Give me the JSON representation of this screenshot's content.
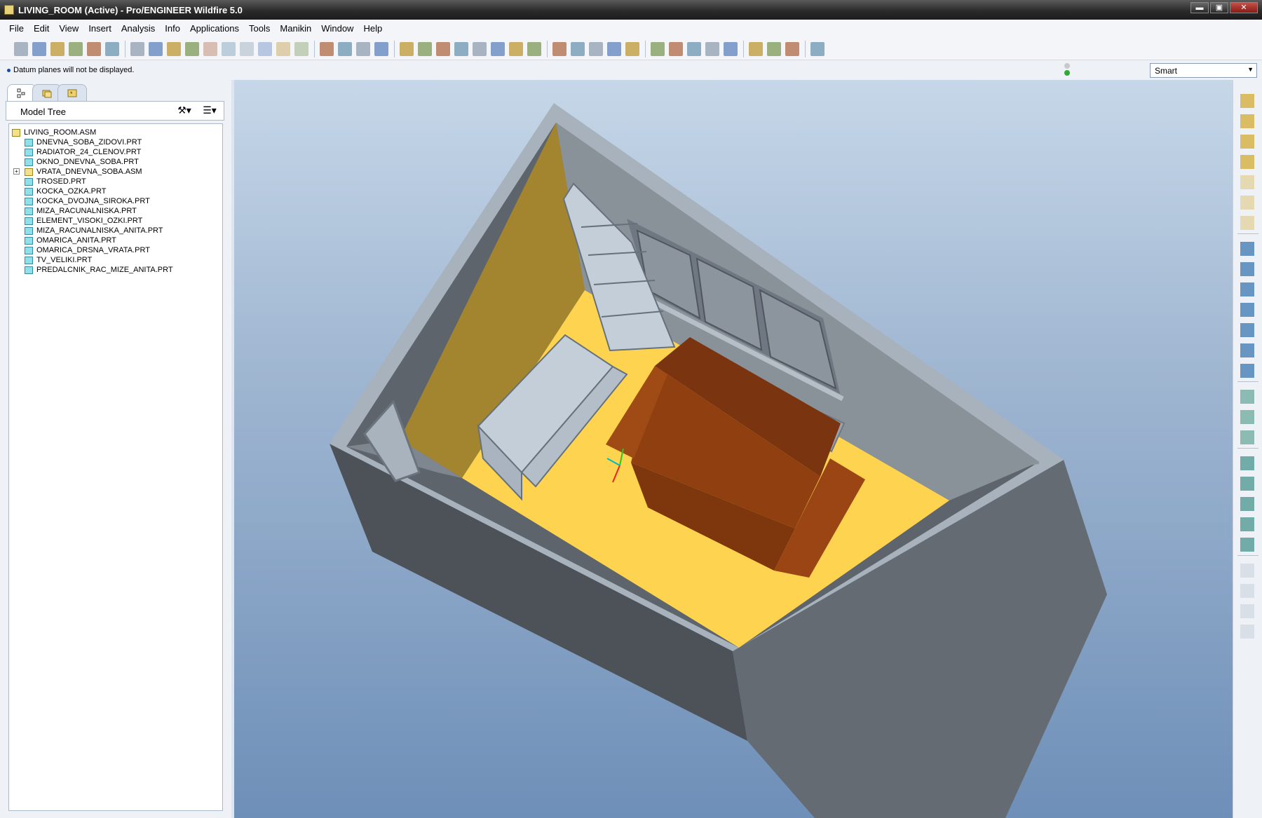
{
  "window": {
    "title": "LIVING_ROOM (Active) - Pro/ENGINEER Wildfire 5.0",
    "minimize": "▬",
    "maximize": "▣",
    "close": "✕"
  },
  "menu": [
    "File",
    "Edit",
    "View",
    "Insert",
    "Analysis",
    "Info",
    "Applications",
    "Tools",
    "Manikin",
    "Window",
    "Help"
  ],
  "status": {
    "message": "Datum planes will not be displayed.",
    "filter_value": "Smart"
  },
  "model_tree": {
    "header": "Model Tree",
    "items": [
      {
        "label": "LIVING_ROOM.ASM",
        "type": "asm",
        "level": 0,
        "expandable": false
      },
      {
        "label": "DNEVNA_SOBA_ZIDOVI.PRT",
        "type": "prt",
        "level": 1,
        "expandable": false
      },
      {
        "label": "RADIATOR_24_CLENOV.PRT",
        "type": "prt",
        "level": 1,
        "expandable": false
      },
      {
        "label": "OKNO_DNEVNA_SOBA.PRT",
        "type": "prt",
        "level": 1,
        "expandable": false
      },
      {
        "label": "VRATA_DNEVNA_SOBA.ASM",
        "type": "asm",
        "level": 1,
        "expandable": true
      },
      {
        "label": "TROSED.PRT",
        "type": "prt",
        "level": 1,
        "expandable": false
      },
      {
        "label": "KOCKA_OZKA.PRT",
        "type": "prt",
        "level": 1,
        "expandable": false
      },
      {
        "label": "KOCKA_DVOJNA_SIROKA.PRT",
        "type": "prt",
        "level": 1,
        "expandable": false
      },
      {
        "label": "MIZA_RACUNALNISKA.PRT",
        "type": "prt",
        "level": 1,
        "expandable": false
      },
      {
        "label": "ELEMENT_VISOKI_OZKI.PRT",
        "type": "prt",
        "level": 1,
        "expandable": false
      },
      {
        "label": "MIZA_RACUNALNISKA_ANITA.PRT",
        "type": "prt",
        "level": 1,
        "expandable": false
      },
      {
        "label": "OMARICA_ANITA.PRT",
        "type": "prt",
        "level": 1,
        "expandable": false
      },
      {
        "label": "OMARICA_DRSNA_VRATA.PRT",
        "type": "prt",
        "level": 1,
        "expandable": false
      },
      {
        "label": "TV_VELIKI.PRT",
        "type": "prt",
        "level": 1,
        "expandable": false
      },
      {
        "label": "PREDALCNIK_RAC_MIZE_ANITA.PRT",
        "type": "prt",
        "level": 1,
        "expandable": false
      }
    ]
  },
  "toolbar_icons": [
    "new-icon",
    "open-icon",
    "save-icon",
    "print-icon",
    "quick-print-icon",
    "email-icon",
    "undo-icon",
    "redo-icon",
    "cut-icon",
    "copy-icon",
    "paste-icon",
    "paste-special-icon",
    "regenerate-icon",
    "regenerate-manager-icon",
    "find-icon",
    "select-box-icon",
    "sketch-icon",
    "axis-icon",
    "spin-center-icon",
    "render-sphere-icon",
    "pan-icon",
    "zoom-in-icon",
    "zoom-out-icon",
    "refit-icon",
    "reorient-icon",
    "saved-views-icon",
    "layers-icon",
    "view-manager-icon",
    "wireframe-icon",
    "hidden-line-icon",
    "no-hidden-icon",
    "shading-icon",
    "enhanced-realism-icon",
    "datum-plane-display-icon",
    "datum-axis-display-icon",
    "point-display-icon",
    "csys-display-icon",
    "annotation-display-icon",
    "window-activate-icon",
    "window-close-icon",
    "window-cancel-icon",
    "context-help-icon"
  ],
  "right_icons": [
    "assemble-icon",
    "create-component-icon",
    "package-icon",
    "cable-icon",
    "mechanism-icon",
    "pipe-icon",
    "weld-icon",
    "sketch-datum-icon",
    "datum-plane-icon",
    "datum-axis-icon",
    "datum-curve-icon",
    "datum-point-icon",
    "csys-icon",
    "analysis-icon",
    "extrude-icon",
    "revolve-icon",
    "sweep-icon",
    "hole-icon",
    "round-icon",
    "chamfer-icon",
    "rib-icon",
    "shell-icon",
    "mirror-icon",
    "merge-icon",
    "trim-icon",
    "pattern-icon"
  ],
  "colors": {
    "floor": "#fdd34f",
    "wall_dark": "#4e5359",
    "wall_light": "#a9b2bd",
    "accent_wall": "#a4852f",
    "sofa": "#8a3a0c",
    "furniture": "#b9c6d2"
  }
}
